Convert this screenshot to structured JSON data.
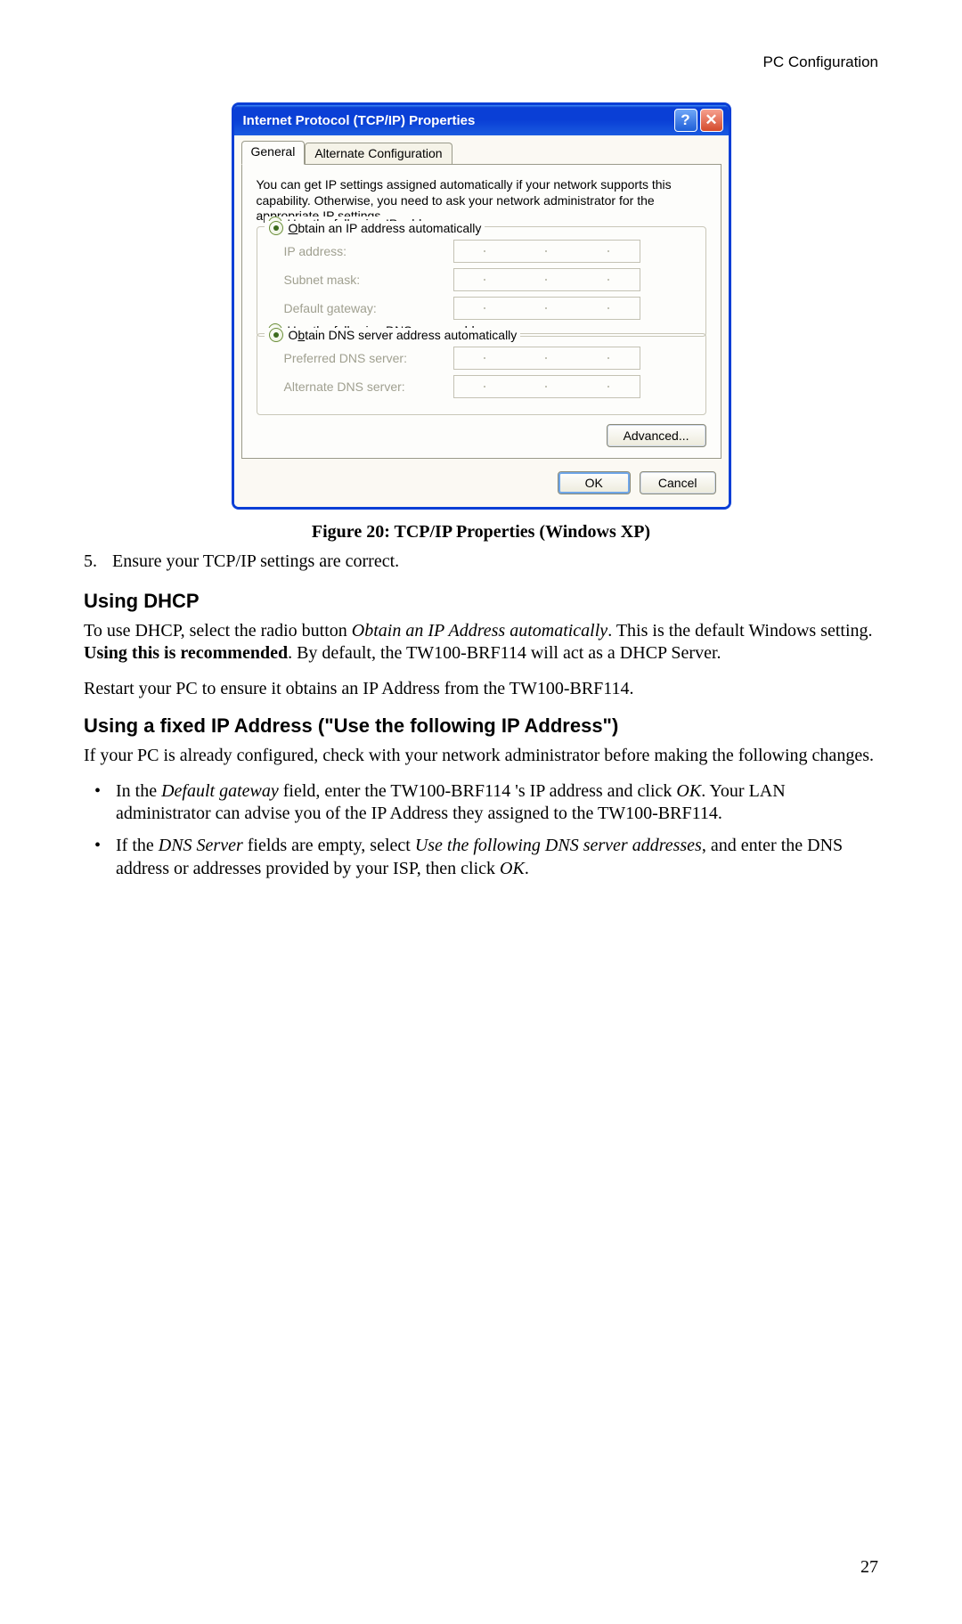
{
  "header": {
    "section": "PC Configuration"
  },
  "dialog": {
    "title": "Internet Protocol (TCP/IP) Properties",
    "help_glyph": "?",
    "close_glyph": "✕",
    "tabs": {
      "general": "General",
      "alt": "Alternate Configuration"
    },
    "intro": "You can get IP settings assigned automatically if your network supports this capability. Otherwise, you need to ask your network administrator for the appropriate IP settings.",
    "radios": {
      "obtain_ip_pre": "O",
      "obtain_ip_rest": "btain an IP address automatically",
      "use_ip_pre": "U",
      "use_ip_rest": "se the following IP address:",
      "obtain_dns_pre": "O",
      "obtain_dns_mid": "b",
      "obtain_dns_rest": "tain DNS server address automatically",
      "use_dns_pre": "Us",
      "use_dns_mid": "e",
      "use_dns_rest": " the following DNS server addresses:"
    },
    "fields": {
      "ip_address": "IP address:",
      "subnet": "Subnet mask:",
      "gateway": "Default gateway:",
      "pref_dns": "Preferred DNS server:",
      "alt_dns": "Alternate DNS server:"
    },
    "buttons": {
      "advanced": "Advanced...",
      "ok": "OK",
      "cancel": "Cancel"
    }
  },
  "caption": "Figure 20: TCP/IP Properties (Windows XP)",
  "step5": {
    "num": "5.",
    "text": "Ensure your TCP/IP settings are correct."
  },
  "section_dhcp": {
    "heading": "Using DHCP",
    "p1_a": "To use DHCP, select the radio button ",
    "p1_b": "Obtain an IP Address automatically",
    "p1_c": ". This is the default Windows setting. ",
    "p1_d": "Using this is recommended",
    "p1_e": ". By default, the TW100-BRF114 will act as a DHCP Server.",
    "p2": "Restart your PC to ensure it obtains an IP Address from the TW100-BRF114."
  },
  "section_fixed": {
    "heading": "Using a fixed IP Address (\"Use the following IP Address\")",
    "intro": "If your PC is already configured, check with your network administrator before making the following changes.",
    "b1_a": "In the ",
    "b1_b": "Default gateway",
    "b1_c": " field, enter the TW100-BRF114 's IP address and click ",
    "b1_d": "OK",
    "b1_e": ". Your LAN administrator can advise you of the IP Address they assigned to the TW100-BRF114.",
    "b2_a": "If the ",
    "b2_b": "DNS Server",
    "b2_c": " fields are empty, select ",
    "b2_d": "Use the following DNS server addresses",
    "b2_e": ", and enter the DNS address or addresses provided by your ISP, then click ",
    "b2_f": "OK",
    "b2_g": "."
  },
  "page_number": "27"
}
